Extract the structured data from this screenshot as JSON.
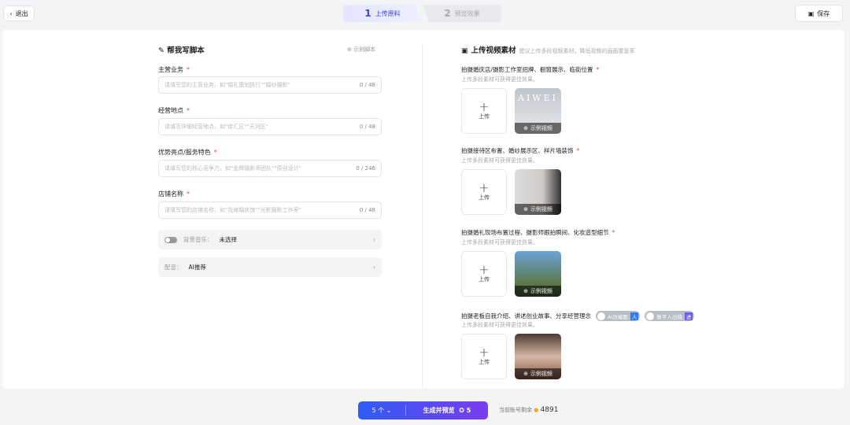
{
  "header": {
    "exit_label": "退出",
    "save_label": "保存",
    "steps": [
      {
        "num": "1",
        "label": "上传原料"
      },
      {
        "num": "2",
        "label": "预览效果"
      }
    ]
  },
  "script": {
    "title": "帮我写脚本",
    "example_label": "示例脚本",
    "fields": [
      {
        "label": "主营业务",
        "placeholder": "请填写您的主营业务，如\"婚礼策划执行\"\"婚纱摄影\"",
        "count": "0 / 48"
      },
      {
        "label": "经营地点",
        "placeholder": "请填写详细经营地点，如\"徐汇区\"\"天河区\"",
        "count": "0 / 48"
      },
      {
        "label": "优势亮点/服务特色",
        "placeholder": "请填写您的核心竞争力，如\"金牌摄影师团队\"\"原创设计\"",
        "count": "0 / 246"
      },
      {
        "label": "店铺名称",
        "placeholder": "请填写您的店铺名称，如\"花嫁婚庆馆\"\"光影摄影工作室\"",
        "count": "0 / 48"
      }
    ],
    "required_mark": "*",
    "music": {
      "key": "背景音乐：",
      "value": "未选择"
    },
    "voice": {
      "key": "配音：",
      "value": "AI推荐"
    }
  },
  "upload": {
    "title": "上传视频素材",
    "hint": "建议上传多段视频素材，降低视频的画面重复率",
    "upload_label": "上传",
    "example_label": "示例视频",
    "sub": "上传多段素材可获得更佳效果。",
    "sections": [
      {
        "title": "拍摄婚庆店/摄影工作室招牌、橱窗展示、临街位置"
      },
      {
        "title": "拍摄接待区布置、婚纱展示区、样片墙装饰"
      },
      {
        "title": "拍摄婚礼现场布置过程、摄影师跟拍瞬间、化妆造型细节"
      },
      {
        "title": "拍摄老板自我介绍、讲述创业故事、分享经营理念"
      }
    ],
    "toggles": [
      {
        "label": "AI改编图",
        "badge": "人"
      },
      {
        "label": "数字人出镜",
        "badge": "进"
      }
    ],
    "thumb_text": "AIWEI"
  },
  "footer": {
    "count_label": "5 个",
    "generate_label": "生成并预览",
    "cost": "5",
    "balance_label": "当前账号剩余",
    "balance": "4891"
  }
}
